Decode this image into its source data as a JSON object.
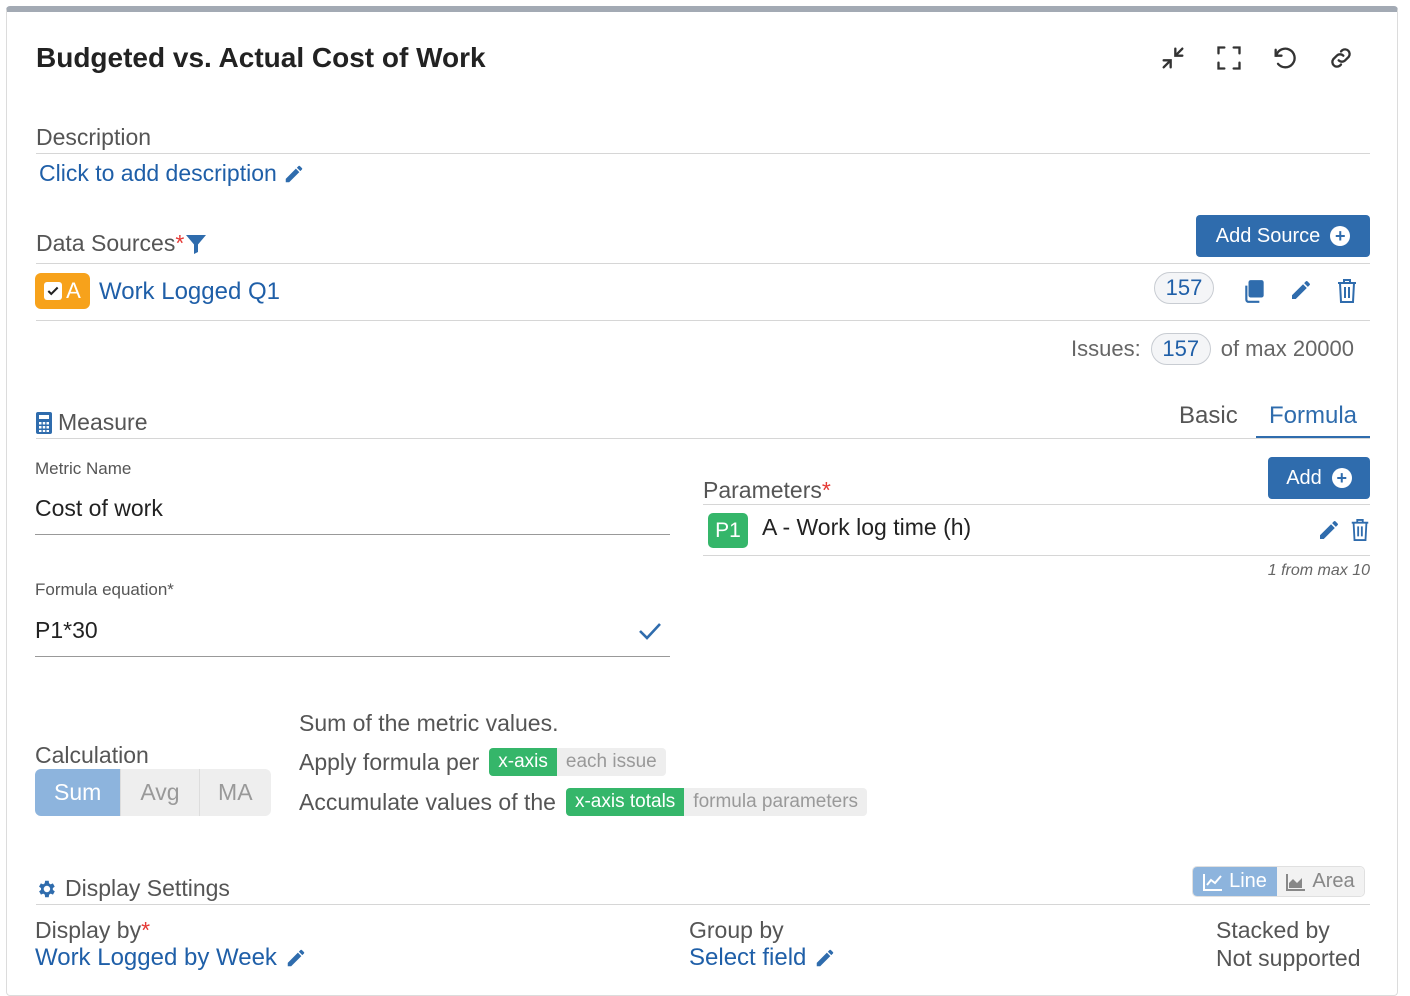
{
  "title": "Budgeted vs. Actual Cost of Work",
  "toolbar": {
    "icons": [
      "minimize-icon",
      "fullscreen-icon",
      "reset-icon",
      "link-icon"
    ]
  },
  "description": {
    "label": "Description",
    "placeholder": "Click to add description"
  },
  "data_sources": {
    "label": "Data Sources",
    "required_mark": "*",
    "add_button": "Add Source",
    "source": {
      "letter": "A",
      "name": "Work Logged Q1",
      "count": "157"
    },
    "issues_label": "Issues:",
    "issues_count": "157",
    "issues_max": "of max 20000"
  },
  "measure": {
    "label": "Measure",
    "tabs": {
      "basic": "Basic",
      "formula": "Formula",
      "active": "Formula"
    },
    "metric_name_label": "Metric Name",
    "metric_name_value": "Cost of work",
    "formula_label": "Formula equation*",
    "formula_value": "P1*30",
    "parameters_label": "Parameters",
    "parameters_required": "*",
    "add_button": "Add",
    "parameter": {
      "id": "P1",
      "name": "A - Work log time (h)"
    },
    "param_limit": "1 from max 10"
  },
  "calculation": {
    "label": "Calculation",
    "options": [
      "Sum",
      "Avg",
      "MA"
    ],
    "selected": "Sum",
    "summary": "Sum of the metric values.",
    "apply_text": "Apply formula per",
    "apply_on": "x-axis",
    "apply_off": "each issue",
    "accumulate_text": "Accumulate values of the",
    "accumulate_on": "x-axis totals",
    "accumulate_off": "formula parameters"
  },
  "display_settings": {
    "label": "Display Settings",
    "chart_types": {
      "line": "Line",
      "area": "Area",
      "selected": "Line"
    },
    "display_by_label": "Display by",
    "display_by_required": "*",
    "display_by_value": "Work Logged by Week",
    "group_by_label": "Group by",
    "group_by_value": "Select field",
    "stacked_by_label": "Stacked by",
    "stacked_by_value": "Not supported"
  },
  "colors": {
    "accent": "#2f6cad",
    "source_badge": "#f7a21b",
    "param_badge": "#35b66a",
    "required": "#e53935"
  }
}
